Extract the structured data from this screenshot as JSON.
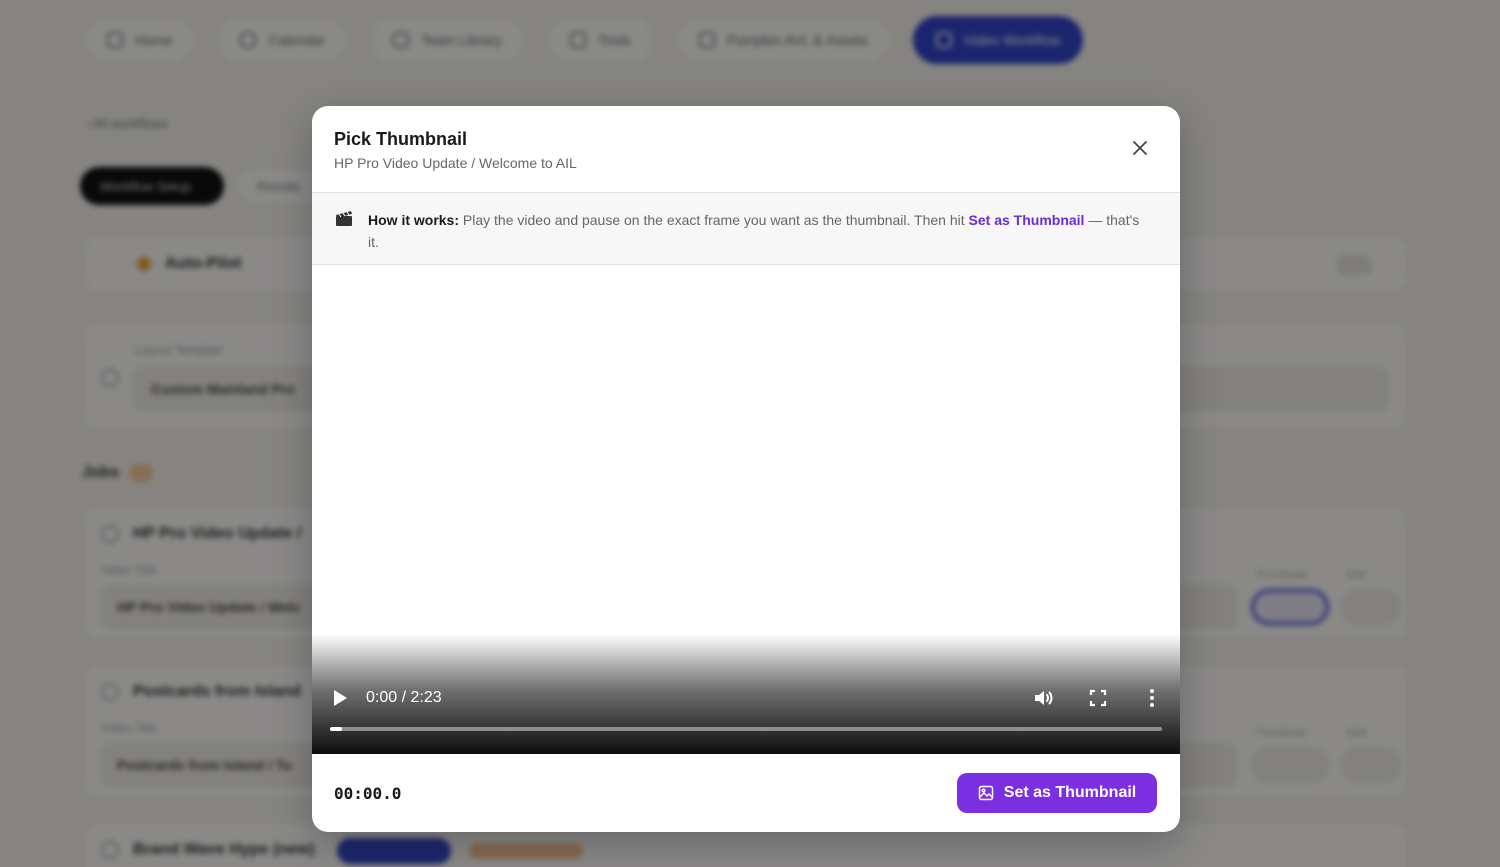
{
  "background": {
    "nav": [
      {
        "label": "Home"
      },
      {
        "label": "Calendar"
      },
      {
        "label": "Team Library"
      },
      {
        "label": "Tools"
      },
      {
        "label": "Pumpkin AVL & Assets"
      },
      {
        "label": "Video Workflow"
      }
    ],
    "back_link": "All workflows",
    "pills": [
      "Workflow Setup",
      "Results"
    ],
    "autopilot_title": "Auto-Pilot",
    "field_label": "Layout Template",
    "field_value": "Custom Mainland Pro",
    "section_title": "Jobs",
    "rows": [
      {
        "title": "HP Pro Video Update / ",
        "field_label": "Video Title",
        "field_value": "HP Pro Video Update / Welc"
      },
      {
        "title": "Postcards from Island",
        "field_label": "Video Title",
        "field_value": "Postcards from Island / Tu"
      },
      {
        "title": "Brand Wave Hype (new)"
      }
    ],
    "col_labels": [
      "Thumbnail",
      "Edit"
    ]
  },
  "modal": {
    "title": "Pick Thumbnail",
    "subtitle": "HP Pro Video Update / Welcome to AIL",
    "info": {
      "lead": "How it works:",
      "text": "Play the video and pause on the exact frame you want as the thumbnail. Then hit",
      "action": "Set as Thumbnail",
      "tail": "— that's it."
    },
    "player": {
      "time": "0:00 / 2:23",
      "progress": 0.01
    },
    "footer": {
      "timecode": "00:00.0",
      "primary_label": "Set as Thumbnail"
    }
  },
  "colors": {
    "accent": "#7a2fe0",
    "accent_text": "#6a2bd9",
    "nav_active": "#3244c8"
  }
}
